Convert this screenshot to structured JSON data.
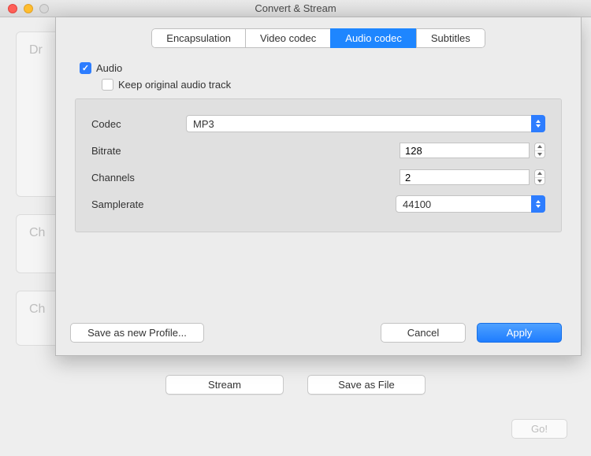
{
  "window": {
    "title": "Convert & Stream"
  },
  "background": {
    "box1_hint": "Dr",
    "box2_hint": "Ch",
    "box3_hint": "Ch",
    "stream_button": "Stream",
    "save_as_file_button": "Save as File",
    "go_button": "Go!"
  },
  "sheet": {
    "tabs": {
      "encapsulation": "Encapsulation",
      "video_codec": "Video codec",
      "audio_codec": "Audio codec",
      "subtitles": "Subtitles"
    },
    "checkboxes": {
      "audio_label": "Audio",
      "keep_original_label": "Keep original audio track"
    },
    "form": {
      "codec_label": "Codec",
      "codec_value": "MP3",
      "bitrate_label": "Bitrate",
      "bitrate_value": "128",
      "channels_label": "Channels",
      "channels_value": "2",
      "samplerate_label": "Samplerate",
      "samplerate_value": "44100"
    },
    "buttons": {
      "save_profile": "Save as new Profile...",
      "cancel": "Cancel",
      "apply": "Apply"
    }
  }
}
